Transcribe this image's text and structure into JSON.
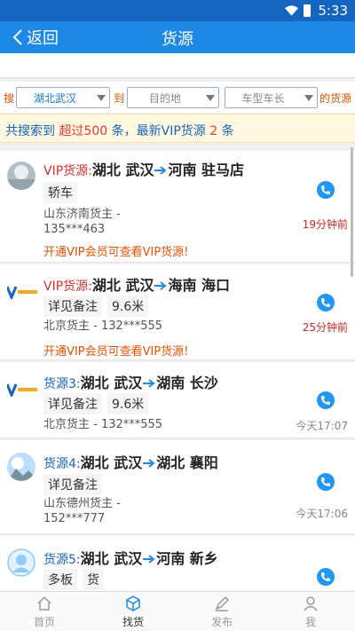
{
  "status_bar": {
    "time": "5:33"
  },
  "nav": {
    "back_label": "返回",
    "title": "货源"
  },
  "search": {
    "prefix": "搜",
    "origin": "湖北武汉",
    "to1": "到",
    "destination_placeholder": "目的地",
    "vehicle_placeholder": "车型车长",
    "suffix": "的货源"
  },
  "summary": {
    "part1": "共搜索到 ",
    "count": "超过500",
    "part2": " 条，最新VIP货源 ",
    "vip_count": "2",
    "part3": " 条"
  },
  "cards": [
    {
      "prefix": "VIP货源:",
      "from": "湖北 武汉",
      "to": "河南 驻马店",
      "tags": [
        "轿车"
      ],
      "owner_line1": "山东济南货主 -",
      "owner_line2": "135***463",
      "time": "19分钟前",
      "vip_note": "开通VIP会员可查看VIP货源!"
    },
    {
      "prefix": "VIP货源:",
      "from": "湖北 武汉",
      "to": "海南 海口",
      "tags": [
        "详见备注",
        "9.6米"
      ],
      "owner_line1": "北京货主 - 132***555",
      "owner_line2": "",
      "time": "25分钟前",
      "vip_note": "开通VIP会员可查看VIP货源!"
    },
    {
      "prefix": "货源3:",
      "from": "湖北 武汉",
      "to": "湖南 长沙",
      "tags": [
        "详见备注",
        "9.6米"
      ],
      "owner_line1": "北京货主 - 132***555",
      "owner_line2": "",
      "time": "今天17:07"
    },
    {
      "prefix": "货源4:",
      "from": "湖北 武汉",
      "to": "湖北 襄阳",
      "tags": [
        "详见备注"
      ],
      "owner_line1": "山东德州货主 -",
      "owner_line2": "152***777",
      "time": "今天17:06"
    },
    {
      "prefix": "货源5:",
      "from": "湖北 武汉",
      "to": "河南 新乡",
      "tags": [
        "多板",
        "货"
      ],
      "owner_line1": "",
      "owner_line2": "",
      "time": ""
    }
  ],
  "tabs": [
    {
      "label": "首页",
      "icon": "home-icon"
    },
    {
      "label": "找货",
      "icon": "cube-icon"
    },
    {
      "label": "发布",
      "icon": "pen-icon"
    },
    {
      "label": "我",
      "icon": "user-icon"
    }
  ],
  "colors": {
    "primary": "#1e88e5",
    "vip_red": "#d32f2f",
    "orange": "#e65100"
  }
}
